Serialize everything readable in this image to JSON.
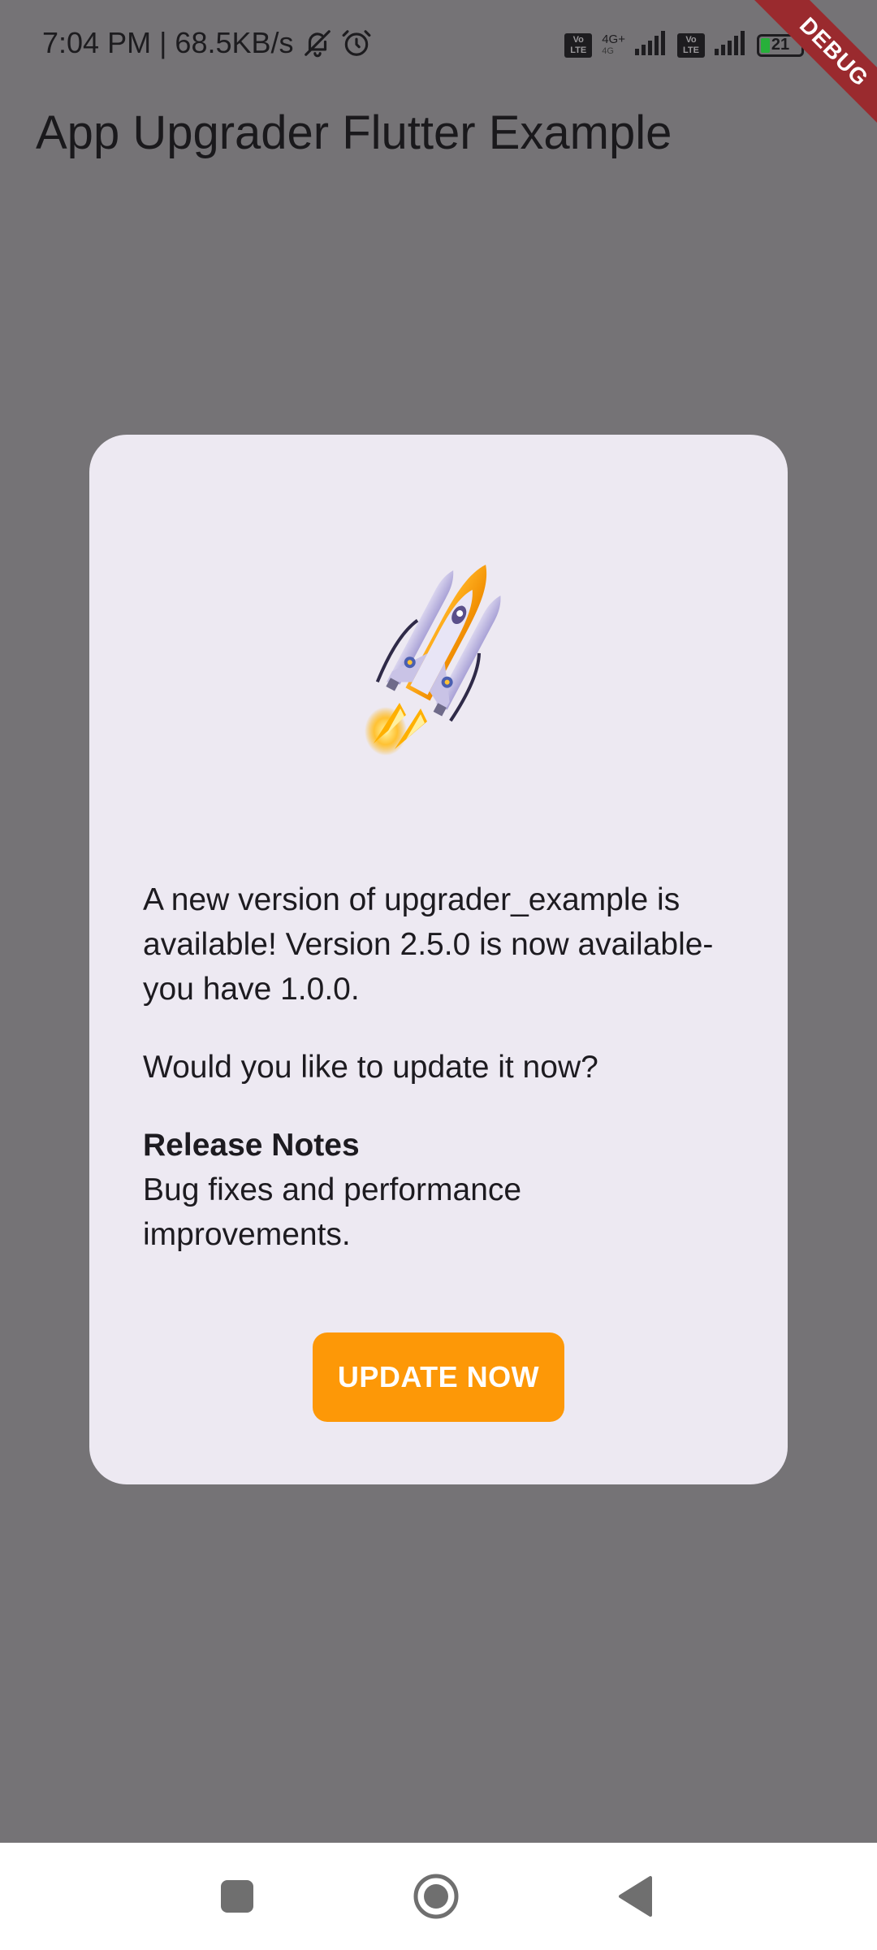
{
  "status_bar": {
    "time_speed": "7:04 PM | 68.5KB/s",
    "volte_1": "Vo LTE",
    "network_type": "4G+",
    "network_sub": "4G",
    "volte_2": "Vo LTE",
    "battery_level": "21",
    "battery_fraction": 0.21,
    "icons": [
      "bell-off-icon",
      "alarm-icon",
      "signal-icon",
      "battery-icon"
    ]
  },
  "debug_banner": "DEBUG",
  "app_bar": {
    "title": "App Upgrader Flutter Example"
  },
  "dialog": {
    "icon": "rocket-icon",
    "message": "A new version of upgrader_example is available! Version 2.5.0 is now available-you have 1.0.0.",
    "prompt": "Would you like to update it now?",
    "release_notes_title": "Release Notes",
    "release_notes_body": "Bug fixes and performance improvements.",
    "update_button": "UPDATE NOW"
  },
  "colors": {
    "scrim": "#757376",
    "dialog_bg": "#ede9f2",
    "accent": "#fd9807",
    "debug_banner": "#9a2a2e"
  },
  "nav_bar": {
    "items": [
      "recents-icon",
      "home-icon",
      "back-icon"
    ]
  }
}
